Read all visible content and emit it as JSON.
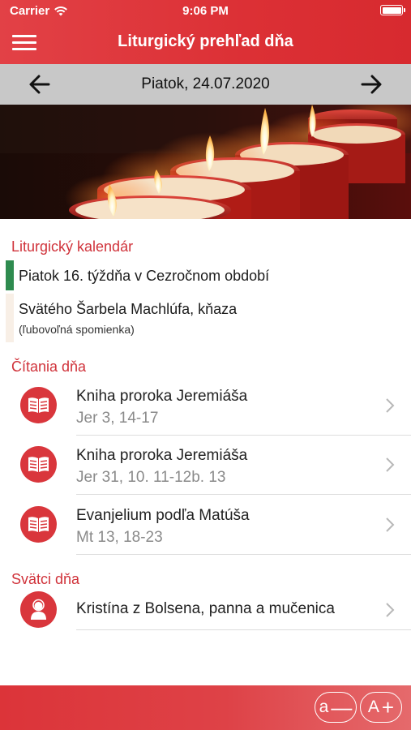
{
  "status_bar": {
    "carrier": "Carrier",
    "time": "9:06 PM"
  },
  "header": {
    "title": "Liturgický prehľad dňa"
  },
  "date_nav": {
    "date": "Piatok, 24.07.2020"
  },
  "liturgical_calendar": {
    "title": "Liturgický kalendár",
    "entries": [
      {
        "title": "Piatok 16. týždňa v Cezročnom období",
        "subtitle": "",
        "color": "#2e8b4f"
      },
      {
        "title": "Svätého Šarbela Machlúfa, kňaza",
        "subtitle": "(ľubovoľná spomienka)",
        "color": "#f8efe6"
      }
    ]
  },
  "readings": {
    "title": "Čítania dňa",
    "items": [
      {
        "title": "Kniha proroka Jeremiáša",
        "reference": "Jer 3, 14-17",
        "icon": "open-book-icon"
      },
      {
        "title": "Kniha proroka Jeremiáša",
        "reference": "Jer 31, 10. 11-12b. 13",
        "icon": "open-book-icon"
      },
      {
        "title": "Evanjelium podľa Matúša",
        "reference": "Mt 13, 18-23",
        "icon": "open-book-icon"
      }
    ]
  },
  "saints": {
    "title": "Svätci dňa",
    "items": [
      {
        "name": "Kristína z Bolsena, panna a mučenica",
        "icon": "saint-icon"
      }
    ]
  },
  "font_controls": {
    "decrease_letter": "a",
    "decrease_symbol": "—",
    "increase_letter": "A",
    "increase_symbol": "+"
  },
  "colors": {
    "accent_red": "#dc3035",
    "section_title": "#d0323a",
    "date_bar": "#c8c8c8",
    "ordinary_time_green": "#2e8b4f"
  }
}
